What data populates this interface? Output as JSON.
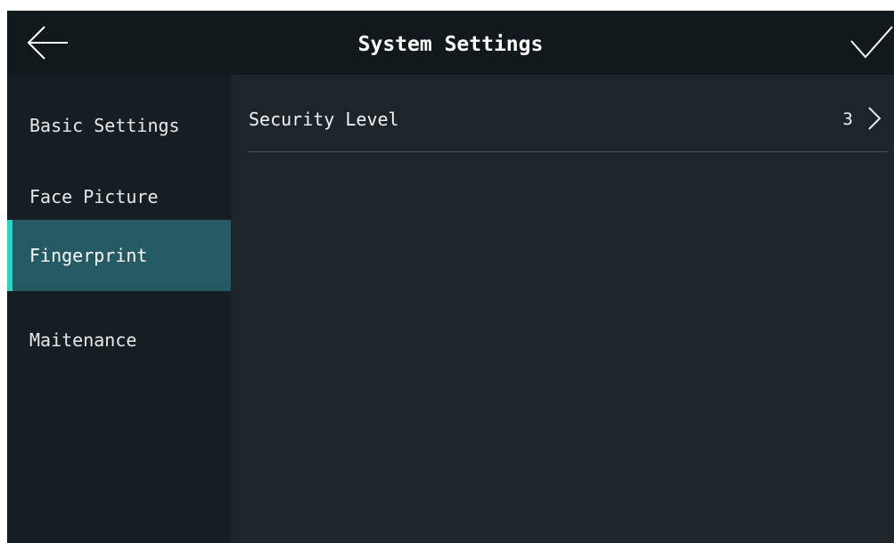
{
  "header": {
    "title": "System Settings",
    "back_icon": "arrow-left-icon",
    "confirm_icon": "checkmark-icon"
  },
  "sidebar": {
    "items": [
      {
        "label": "Basic Settings",
        "active": false
      },
      {
        "label": "Face Picture",
        "active": false
      },
      {
        "label": "Fingerprint",
        "active": true
      },
      {
        "label": "Maitenance",
        "active": false
      }
    ]
  },
  "content": {
    "rows": [
      {
        "label": "Security Level",
        "value": "3",
        "icon": "chevron-right-icon"
      }
    ]
  },
  "colors": {
    "background": "#1d252b",
    "header": "#12191d",
    "sidebar": "#171e23",
    "active_item": "#245a63",
    "accent": "#2ad3c3",
    "divider": "#4a5359"
  }
}
